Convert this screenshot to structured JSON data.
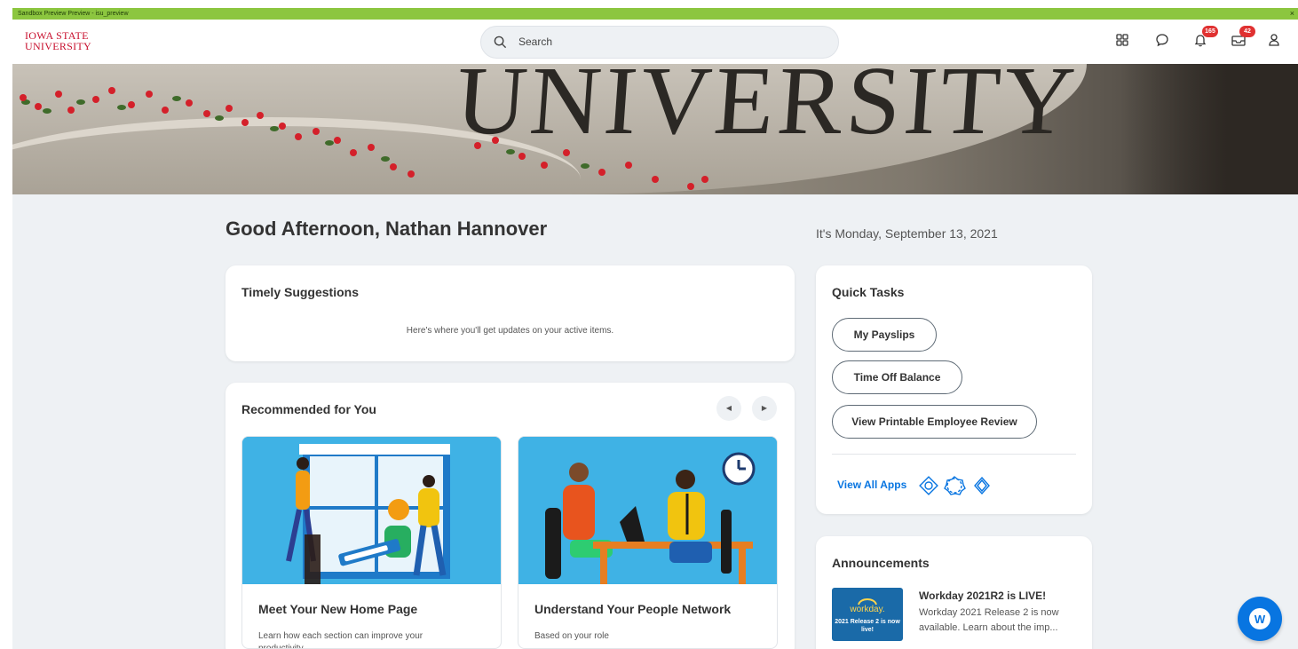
{
  "env_bar": {
    "label": "Sandbox Preview Preview - isu_preview",
    "close": "×"
  },
  "header": {
    "logo_line1": "IOWA STATE",
    "logo_line2": "UNIVERSITY",
    "search_placeholder": "Search",
    "notifications_count": "165",
    "inbox_count": "42",
    "icons": [
      "apps-icon",
      "chat-icon",
      "bell-icon",
      "inbox-icon",
      "profile-icon"
    ]
  },
  "hero": {
    "word": "UNIVERSITY"
  },
  "greeting": "Good Afternoon, Nathan Hannover",
  "date": "It's Monday, September 13, 2021",
  "timely": {
    "title": "Timely Suggestions",
    "message": "Here's where you'll get updates on your active items."
  },
  "recommended": {
    "title": "Recommended for You",
    "prev": "◀",
    "next": "▶",
    "cards": [
      {
        "title": "Meet Your New Home Page",
        "desc": "Learn how each section can improve your productivity."
      },
      {
        "title": "Understand Your People Network",
        "desc": "Based on your role"
      }
    ]
  },
  "quick_tasks": {
    "title": "Quick Tasks",
    "tasks": [
      "My Payslips",
      "Time Off Balance",
      "View Printable Employee Review"
    ],
    "view_all": "View All Apps"
  },
  "announcements": {
    "title": "Announcements",
    "image_brand": "workday.",
    "image_caption": "2021 Release 2 is now live!",
    "item_title": "Workday 2021R2 is LIVE!",
    "item_body": "Workday 2021 Release 2 is now available. Learn about the imp..."
  },
  "colors": {
    "accent": "#0875e1",
    "brand_red": "#c8102e",
    "sandbox_green": "#8cc63f",
    "page_bg": "#eef1f4"
  }
}
